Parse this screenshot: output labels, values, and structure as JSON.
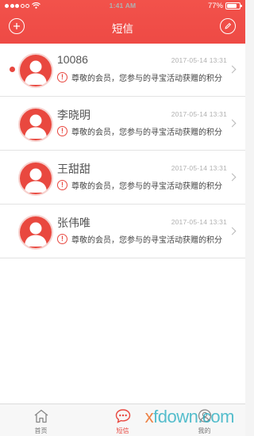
{
  "status_bar": {
    "time": "1:41 AM",
    "battery_text": "77%",
    "battery_level": 0.77
  },
  "header": {
    "title": "短信"
  },
  "messages": [
    {
      "name": "10086",
      "time": "2017-05-14   13:31",
      "snippet": "尊敬的会员，您参与的寻宝活动获赠的积分",
      "unread": true
    },
    {
      "name": "李晓明",
      "time": "2017-05-14   13:31",
      "snippet": "尊敬的会员，您参与的寻宝活动获赠的积分",
      "unread": false
    },
    {
      "name": "王甜甜",
      "time": "2017-05-14   13:31",
      "snippet": "尊敬的会员，您参与的寻宝活动获赠的积分",
      "unread": false
    },
    {
      "name": "张伟唯",
      "time": "2017-05-14   13:31",
      "snippet": "尊敬的会员，您参与的寻宝活动获赠的积分",
      "unread": false
    }
  ],
  "warning_glyph": "!",
  "tabs": [
    {
      "label": "首页",
      "icon": "home-icon",
      "active": false
    },
    {
      "label": "短信",
      "icon": "message-icon",
      "active": true
    },
    {
      "label": "我的",
      "icon": "profile-icon",
      "active": false
    }
  ],
  "watermark": {
    "prefix": "x",
    "text": "fdown.com"
  },
  "colors": {
    "accent": "#e8473f",
    "header": "#ef4c46"
  }
}
